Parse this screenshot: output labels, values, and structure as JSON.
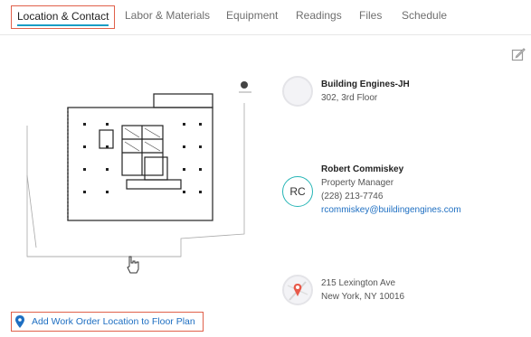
{
  "tabs": [
    {
      "label": "Location & Contact",
      "active": true
    },
    {
      "label": "Labor & Materials"
    },
    {
      "label": "Equipment"
    },
    {
      "label": "Readings"
    },
    {
      "label": "Files"
    },
    {
      "label": "Schedule"
    }
  ],
  "building": {
    "name": "Building Engines-JH",
    "location": "302, 3rd Floor"
  },
  "contact": {
    "initials": "RC",
    "name": "Robert Commiskey",
    "title": "Property Manager",
    "phone": "(228) 213-7746",
    "email": "rcommiskey@buildingengines.com"
  },
  "address": {
    "line1": "215 Lexington Ave",
    "line2": "New York, NY 10016"
  },
  "actions": {
    "add_location_label": "Add Work Order Location to Floor Plan"
  },
  "icons": {
    "edit": "edit-icon",
    "pin": "map-pin-icon",
    "map": "map-thumbnail-icon",
    "cursor": "hand-cursor-icon"
  },
  "colors": {
    "highlight_border": "#e0604a",
    "active_underline": "#1a9dc4",
    "link": "#1e6fc2",
    "avatar_ring": "#26b5b6"
  }
}
